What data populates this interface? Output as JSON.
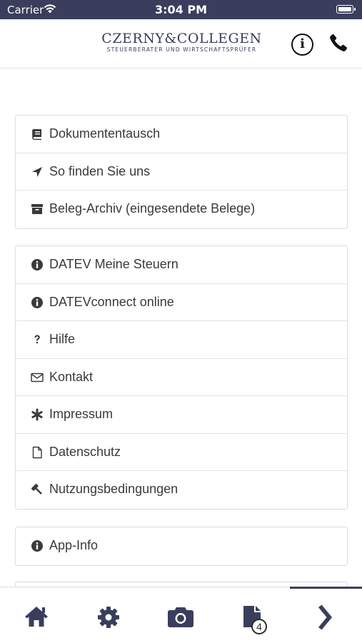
{
  "status_bar": {
    "carrier": "Carrier",
    "time": "3:04 PM"
  },
  "header": {
    "logo_name": "CZERNY&COLLEGEN",
    "logo_subtitle": "STEUERBERATER UND WIRTSCHAFTSPRÜFER",
    "info_icon": "info-circle-icon",
    "phone_icon": "phone-icon"
  },
  "menu_groups": [
    {
      "items": [
        {
          "label": "Dokumententausch",
          "icon": "book-icon"
        },
        {
          "label": "So finden Sie uns",
          "icon": "location-arrow-icon"
        },
        {
          "label": "Beleg-Archiv (eingesendete Belege)",
          "icon": "archive-icon"
        }
      ]
    },
    {
      "items": [
        {
          "label": "DATEV Meine Steuern",
          "icon": "info-icon"
        },
        {
          "label": "DATEVconnect online",
          "icon": "info-icon"
        },
        {
          "label": "Hilfe",
          "icon": "question-icon"
        },
        {
          "label": "Kontakt",
          "icon": "envelope-icon"
        },
        {
          "label": "Impressum",
          "icon": "asterisk-icon"
        },
        {
          "label": "Datenschutz",
          "icon": "file-icon"
        },
        {
          "label": "Nutzungsbedingungen",
          "icon": "gavel-icon"
        }
      ]
    },
    {
      "items": [
        {
          "label": "App-Info",
          "icon": "info-icon"
        }
      ]
    }
  ],
  "tab_bar": {
    "tabs": [
      {
        "icon": "home-icon"
      },
      {
        "icon": "gear-icon"
      },
      {
        "icon": "camera-icon"
      },
      {
        "icon": "document-icon",
        "badge": "4"
      },
      {
        "icon": "chevron-right-icon",
        "active": true
      }
    ]
  },
  "colors": {
    "brand": "#3a3e5c",
    "text": "#3a3a3a",
    "border": "#dcdcdc"
  }
}
